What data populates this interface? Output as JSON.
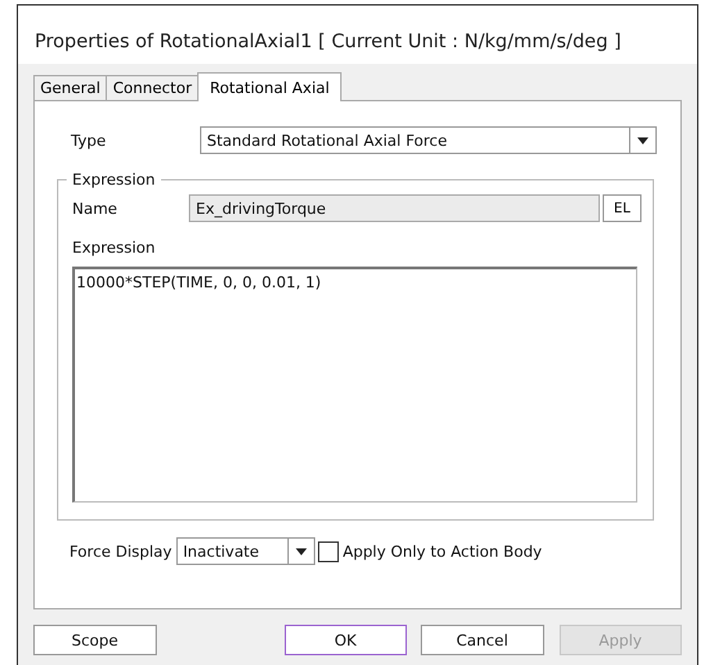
{
  "window": {
    "title": "Properties of RotationalAxial1 [ Current Unit : N/kg/mm/s/deg ]"
  },
  "tabs": [
    {
      "label": "General",
      "selected": false
    },
    {
      "label": "Connector",
      "selected": false
    },
    {
      "label": "Rotational Axial",
      "selected": true
    }
  ],
  "type": {
    "label": "Type",
    "value": "Standard Rotational Axial Force"
  },
  "expression_group": {
    "title": "Expression",
    "name_label": "Name",
    "name_value": "Ex_drivingTorque",
    "el_button": "EL",
    "expression_label": "Expression",
    "expression_value": "10000*STEP(TIME, 0, 0, 0.01, 1)"
  },
  "force_display": {
    "label": "Force Display",
    "value": "Inactivate"
  },
  "apply_only": {
    "label": "Apply Only to Action Body",
    "checked": false
  },
  "buttons": [
    {
      "label": "Scope",
      "disabled": false,
      "focused": false
    },
    {
      "label": "OK",
      "disabled": false,
      "focused": true
    },
    {
      "label": "Cancel",
      "disabled": false,
      "focused": false
    },
    {
      "label": "Apply",
      "disabled": true,
      "focused": false
    }
  ]
}
